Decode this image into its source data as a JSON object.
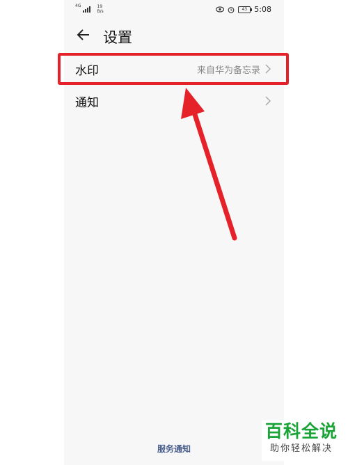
{
  "status_bar": {
    "network": "4G",
    "speed_value": "19",
    "speed_unit": "B/s",
    "battery": "43",
    "time": "5:08"
  },
  "header": {
    "title": "设置"
  },
  "list": {
    "items": [
      {
        "label": "水印",
        "value": "来自华为备忘录"
      },
      {
        "label": "通知",
        "value": ""
      }
    ]
  },
  "footer": {
    "link": "服务通知"
  },
  "watermark": {
    "name": "百科全说",
    "tagline": "助你轻松解决"
  },
  "colors": {
    "highlight": "#e52229",
    "logo_green": "#1aa336",
    "link": "#4a5e8c"
  }
}
